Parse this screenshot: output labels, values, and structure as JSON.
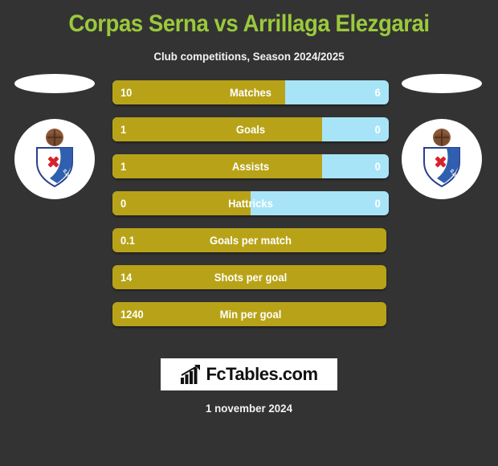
{
  "header": {
    "title": "Corpas Serna vs Arrillaga Elezgarai",
    "subtitle": "Club competitions, Season 2024/2025"
  },
  "badges": {
    "home": {
      "name": "sd-eibar-crest",
      "alt": "SD Eibar"
    },
    "away": {
      "name": "sd-eibar-crest",
      "alt": "SD Eibar"
    }
  },
  "footer": {
    "logo_text": "FcTables.com",
    "logo_icon": "bar-chart-icon",
    "date": "1 november 2024"
  },
  "colors": {
    "background": "#333333",
    "title": "#9ac93c",
    "home_bar": "#b8a318",
    "away_bar": "#a8e4f7",
    "text": "#ffffff"
  },
  "chart_data": {
    "type": "bar",
    "title": "Corpas Serna vs Arrillaga Elezgarai",
    "subtitle": "Club competitions, Season 2024/2025",
    "orientation": "horizontal-split",
    "legend": [
      "Corpas Serna",
      "Arrillaga Elezgarai"
    ],
    "categories": [
      "Matches",
      "Goals",
      "Assists",
      "Hattricks",
      "Goals per match",
      "Shots per goal",
      "Min per goal"
    ],
    "series": [
      {
        "name": "Corpas Serna",
        "values": [
          10,
          1,
          1,
          0,
          0.1,
          14,
          1240
        ]
      },
      {
        "name": "Arrillaga Elezgarai",
        "values": [
          6,
          0,
          0,
          0,
          null,
          null,
          null
        ]
      }
    ],
    "rows": [
      {
        "label": "Matches",
        "home": "10",
        "away": "6",
        "home_pct": 62.5,
        "dual": true
      },
      {
        "label": "Goals",
        "home": "1",
        "away": "0",
        "home_pct": 76,
        "dual": true
      },
      {
        "label": "Assists",
        "home": "1",
        "away": "0",
        "home_pct": 76,
        "dual": true
      },
      {
        "label": "Hattricks",
        "home": "0",
        "away": "0",
        "home_pct": 50,
        "dual": true
      },
      {
        "label": "Goals per match",
        "home": "0.1",
        "away": "",
        "home_pct": 100,
        "dual": false
      },
      {
        "label": "Shots per goal",
        "home": "14",
        "away": "",
        "home_pct": 100,
        "dual": false
      },
      {
        "label": "Min per goal",
        "home": "1240",
        "away": "",
        "home_pct": 100,
        "dual": false
      }
    ]
  }
}
